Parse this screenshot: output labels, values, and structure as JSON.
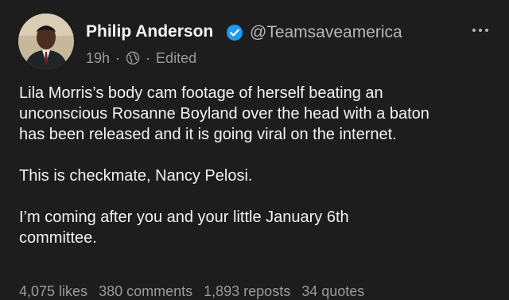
{
  "post": {
    "author_name": "Philip Anderson",
    "handle": "@Teamsaveamerica",
    "time": "19h",
    "separator": "·",
    "edited": "Edited",
    "paragraphs": [
      "Lila Morris’s body cam footage of herself beating an\nunconscious Rosanne Boyland over the head with a baton\nhas been released and it is going viral on the internet.",
      "This is checkmate, Nancy Pelosi.",
      "I’m coming after you and your little January 6th\ncommittee."
    ],
    "stats": {
      "likes": "4,075 likes",
      "comments": "380 comments",
      "reposts": "1,893 reposts",
      "quotes": "34 quotes"
    }
  },
  "icons": {
    "verified": "verified-badge-icon",
    "globe": "globe-icon",
    "more": "more-options-icon"
  },
  "colors": {
    "background": "#1d1d1e",
    "verified": "#1d9bf0",
    "muted": "#9a9a9a"
  }
}
